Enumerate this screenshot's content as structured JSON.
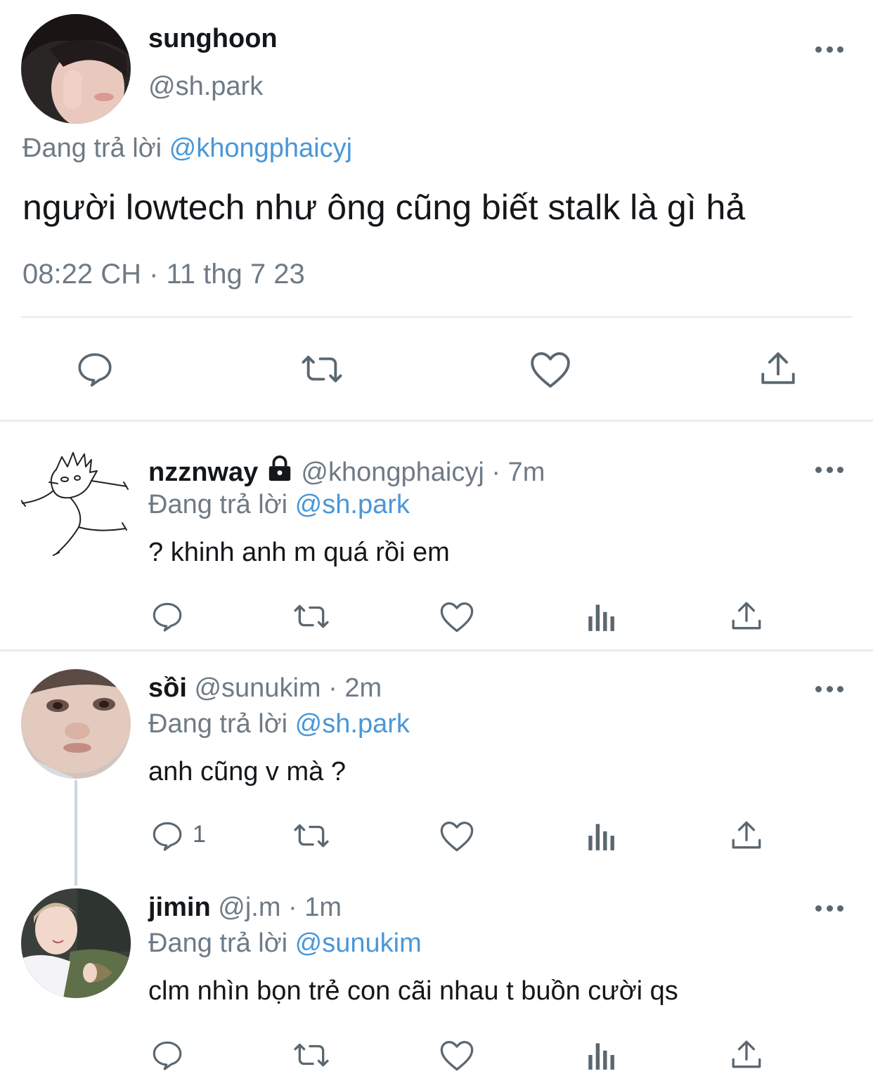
{
  "main_tweet": {
    "display_name": "sunghoon",
    "handle": "@sh.park",
    "reply_prefix": "Đang trả lời",
    "reply_to": "@khongphaicyj",
    "text": "người lowtech như ông cũng biết stalk là gì hả",
    "timestamp": "08:22 CH · 11 thg 7 23"
  },
  "replies": [
    {
      "display_name": "nzznway",
      "handle": "@khongphaicyj",
      "time": "· 7m",
      "reply_prefix": "Đang trả lời",
      "reply_to": "@sh.park",
      "text": "? khinh anh m quá rồi em",
      "locked": true,
      "reply_count": ""
    },
    {
      "display_name": "sồi",
      "handle": "@sunukim",
      "time": "· 2m",
      "reply_prefix": "Đang trả lời",
      "reply_to": "@sh.park",
      "text": "anh cũng v mà ?",
      "reply_count": "1"
    },
    {
      "display_name": "jimin",
      "handle": "@j.m",
      "time": "· 1m",
      "reply_prefix": "Đang trả lời",
      "reply_to": "@sunukim",
      "text": "clm nhìn bọn trẻ con cãi nhau t buồn cười qs",
      "reply_count": ""
    }
  ],
  "icons": [
    "more-icon",
    "reply-icon",
    "retweet-icon",
    "like-icon",
    "share-icon",
    "analytics-icon",
    "lock-icon"
  ],
  "colors": {
    "link": "#4a97d8",
    "secondary": "#6e7b86",
    "icon": "#5b6770",
    "divider": "#e9ecef"
  }
}
